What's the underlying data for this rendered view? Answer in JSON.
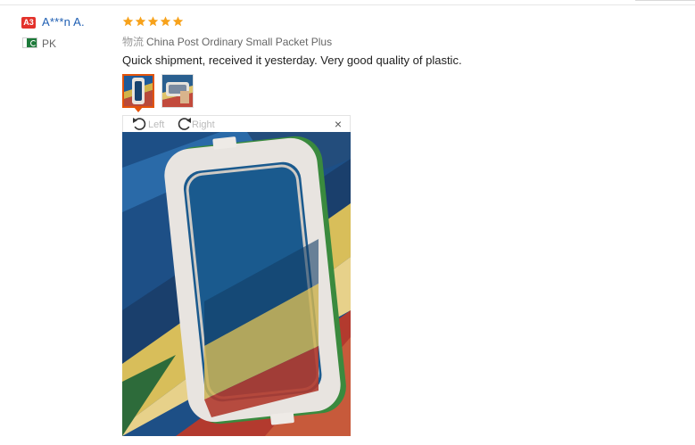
{
  "reviewer": {
    "level_badge": "A3",
    "name": "A***n A.",
    "country_code": "PK",
    "flag_icon": "flag-pk-icon"
  },
  "review": {
    "rating": 5,
    "max_rating": 5,
    "star_color": "#f7a21b",
    "shipping_prefix": "物流",
    "shipping_method": "China Post Ordinary Small Packet Plus",
    "text": "Quick shipment, received it yesterday. Very good quality of plastic."
  },
  "viewer": {
    "rotate_left_label": "Left",
    "rotate_right_label": "Right",
    "close_label": "×",
    "thumbnail_count": 2,
    "selected_thumbnail": 1
  },
  "colors": {
    "accent": "#e2530b",
    "link": "#1f5fb3",
    "badge": "#e3322b"
  }
}
